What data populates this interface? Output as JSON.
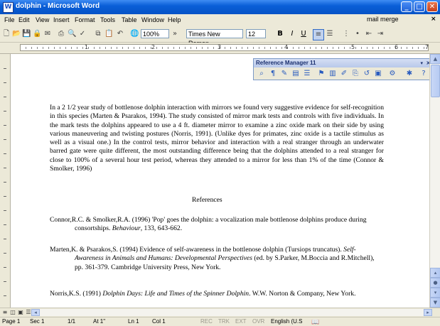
{
  "window": {
    "title": "dolphin - Microsoft Word",
    "app_icon": "word-doc-icon",
    "controls": [
      "minimize-icon",
      "maximize-icon",
      "close-icon"
    ]
  },
  "menu": {
    "items": [
      "File",
      "Edit",
      "View",
      "Insert",
      "Format",
      "Tools",
      "Table",
      "Window",
      "Help"
    ],
    "ask_box": "mail merge",
    "close": "×"
  },
  "toolbar": {
    "zoom": "100%",
    "font": "Times New Roman",
    "size": "12",
    "bold": "B",
    "italic": "I",
    "underline": "U"
  },
  "ruler": {
    "numbers": [
      "1",
      "2",
      "3",
      "4",
      "5",
      "6",
      "7"
    ]
  },
  "ref_manager": {
    "title": "Reference Manager 11",
    "close": "×",
    "dropdown": "▾"
  },
  "document": {
    "paragraph": "In a 2 1/2 year study of bottlenose dolphin interaction with mirrors we found very suggestive evidence for self-recognition in this species (Marten & Psarakos, 1994). The study consisted of mirror mark tests and controls with five individuals. In the mark tests the dolphins appeared to use a 4 ft. diameter mirror to examine a zinc oxide mark on their side by using various maneuvering and twisting postures (Norris, 1991). (Unlike dyes for primates, zinc oxide is a tactile stimulus as well as a visual one.) In the control tests, mirror behavior and interaction with a real stranger through an underwater barred gate were quite different, the most outstanding difference being that the dolphins attended to a real stranger for close to 100% of a several hour test period, whereas they attended to a mirror for less than 1% of the time (Connor & Smolker, 1996)",
    "references_heading": "References",
    "references": [
      {
        "pre": "Connor,R.C. & Smolker,R.A. (1996) 'Pop' goes the dolphin: a vocalization male bottlenose dolphins produce during consortships. ",
        "ital": "Behaviour",
        "post": ", 133, 643-662."
      },
      {
        "pre": "Marten,K. & Psarakos,S. (1994) Evidence of self-awareness in the bottlenose dolphin (Tursiops truncatus). ",
        "ital": "Self-Awareness in Animals and Humans: Developmental Perspectives",
        "post": " (ed. by S.Parker, M.Boccia and R.Mitchell), pp. 361-379. Cambridge University Press, New York."
      },
      {
        "pre": "Norris,K.S. (1991) ",
        "ital": "Dolphin Days: Life and Times of the Spinner Dolphin",
        "post": ". W.W. Norton & Company, New York."
      }
    ]
  },
  "status_bar": {
    "page": "Page 1",
    "sec": "Sec 1",
    "pages": "1/1",
    "at": "At 1\"",
    "ln": "Ln 1",
    "col": "Col 1",
    "rec": "REC",
    "trk": "TRK",
    "ext": "EXT",
    "ovr": "OVR",
    "lang": "English (U.S"
  },
  "colors": {
    "title_bar": "#0a5fd8",
    "chrome": "#ece9d8",
    "scrollbar": "#c8d7f6"
  }
}
